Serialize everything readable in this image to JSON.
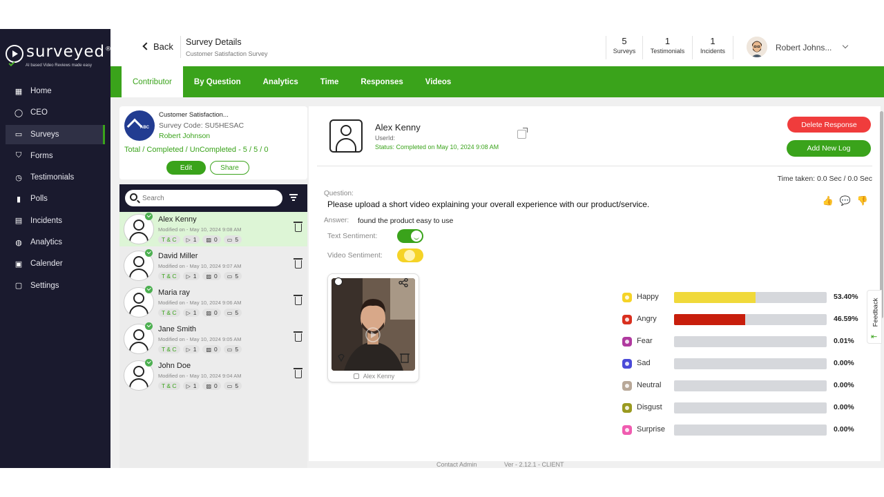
{
  "app": {
    "logo_text": "surveyed",
    "logo_sup": "®",
    "tagline": "AI based Video Reviews made easy"
  },
  "sidebar": {
    "items": [
      {
        "label": "Home",
        "icon": "home-icon",
        "glyph": "▦"
      },
      {
        "label": "CEO",
        "icon": "ceo-icon",
        "glyph": "◯"
      },
      {
        "label": "Surveys",
        "icon": "surveys-icon",
        "glyph": "▭",
        "active": true
      },
      {
        "label": "Forms",
        "icon": "forms-icon",
        "glyph": "⛉"
      },
      {
        "label": "Testimonials",
        "icon": "testimonials-icon",
        "glyph": "◷"
      },
      {
        "label": "Polls",
        "icon": "polls-icon",
        "glyph": "▮"
      },
      {
        "label": "Incidents",
        "icon": "incidents-icon",
        "glyph": "▤"
      },
      {
        "label": "Analytics",
        "icon": "analytics-icon",
        "glyph": "◍"
      },
      {
        "label": "Calender",
        "icon": "calendar-icon",
        "glyph": "▣"
      },
      {
        "label": "Settings",
        "icon": "settings-icon",
        "glyph": "▢"
      }
    ]
  },
  "header": {
    "back_label": "Back",
    "title": "Survey Details",
    "subtitle": "Customer Satisfaction Survey",
    "stats": [
      {
        "num": "5",
        "label": "Surveys"
      },
      {
        "num": "1",
        "label": "Testimonials"
      },
      {
        "num": "1",
        "label": "Incidents"
      }
    ],
    "user_name": "Robert Johns..."
  },
  "tabs": [
    "Contributor",
    "By Question",
    "Analytics",
    "Time",
    "Responses",
    "Videos"
  ],
  "survey_card": {
    "logo_text": "ABC",
    "name": "Customer Satisfaction...",
    "code": "Survey Code: SU5HESAC",
    "owner": "Robert Johnson",
    "totals": "Total / Completed / UnCompleted - 5 / 5 / 0",
    "edit_label": "Edit",
    "share_label": "Share"
  },
  "search": {
    "placeholder": "Search"
  },
  "contributors": [
    {
      "name": "Alex Kenny",
      "modified": "Modified on - May 10, 2024 9:08 AM",
      "tc": "T & C",
      "videos": "1",
      "images": "0",
      "comments": "5",
      "active": true
    },
    {
      "name": "David Miller",
      "modified": "Modified on - May 10, 2024 9:07 AM",
      "tc": "T & C",
      "videos": "1",
      "images": "0",
      "comments": "5"
    },
    {
      "name": "Maria ray",
      "modified": "Modified on - May 10, 2024 9:06 AM",
      "tc": "T & C",
      "videos": "1",
      "images": "0",
      "comments": "5"
    },
    {
      "name": "Jane Smith",
      "modified": "Modified on - May 10, 2024 9:05 AM",
      "tc": "T & C",
      "videos": "1",
      "images": "0",
      "comments": "5"
    },
    {
      "name": "John Doe",
      "modified": "Modified on - May 10, 2024 9:04 AM",
      "tc": "T & C",
      "videos": "1",
      "images": "0",
      "comments": "5"
    }
  ],
  "response": {
    "name": "Alex Kenny",
    "user_id": "UserId:",
    "status": "Status: Completed on May 10, 2024 9:08 AM",
    "delete_label": "Delete Response",
    "add_log_label": "Add New Log",
    "time_taken": "Time taken: 0.0 Sec / 0.0 Sec",
    "question_label": "Question:",
    "question": "Please upload a short video explaining your overall experience with our product/service.",
    "answer_label": "Answer:",
    "answer": "found the product easy to use",
    "text_sentiment_label": "Text Sentiment:",
    "video_sentiment_label": "Video Sentiment:",
    "video_author": "Alex Kenny"
  },
  "emotions": [
    {
      "label": "Happy",
      "pct": "53.40%",
      "value": 53.4,
      "color": "#f0d93a",
      "icon_color": "#f5d327"
    },
    {
      "label": "Angry",
      "pct": "46.59%",
      "value": 46.59,
      "color": "#c81e0c",
      "icon_color": "#d9301f"
    },
    {
      "label": "Fear",
      "pct": "0.01%",
      "value": 0.01,
      "color": "#9c2a8e",
      "icon_color": "#b03a9f"
    },
    {
      "label": "Sad",
      "pct": "0.00%",
      "value": 0.0,
      "color": "#4a4ad8",
      "icon_color": "#4a4ad8"
    },
    {
      "label": "Neutral",
      "pct": "0.00%",
      "value": 0.0,
      "color": "#a89888",
      "icon_color": "#b8a898"
    },
    {
      "label": "Disgust",
      "pct": "0.00%",
      "value": 0.0,
      "color": "#8a8a1a",
      "icon_color": "#9a9a20"
    },
    {
      "label": "Surprise",
      "pct": "0.00%",
      "value": 0.0,
      "color": "#e84fa4",
      "icon_color": "#f05cb0"
    }
  ],
  "feedback_label": "Feedback",
  "footer": {
    "contact": "Contact Admin",
    "version": "Ver - 2.12.1 - CLIENT"
  },
  "colors": {
    "brand_green": "#3aa31b",
    "sidebar_bg": "#1a1a2e",
    "danger": "#f03c3c"
  }
}
